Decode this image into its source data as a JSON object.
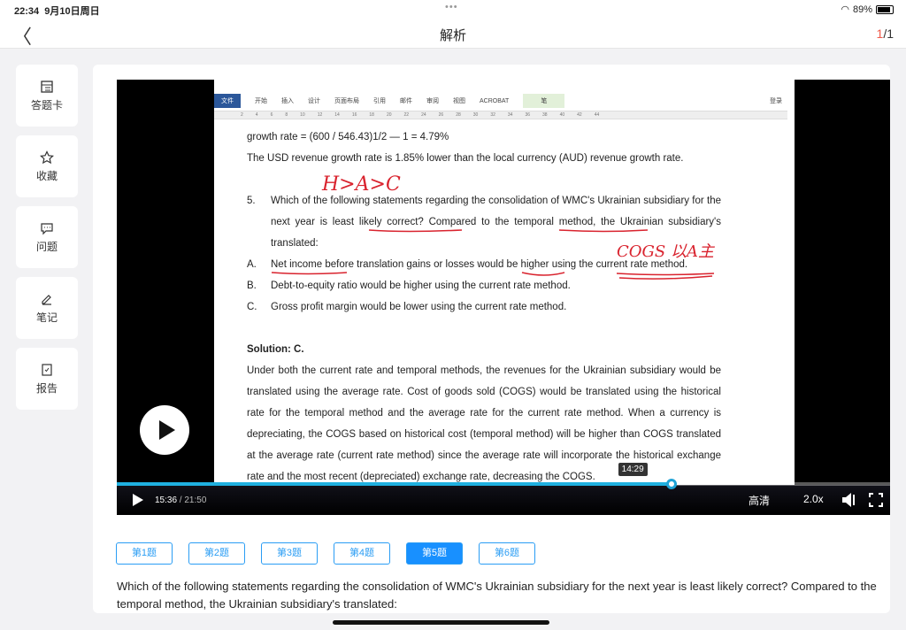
{
  "status": {
    "time": "22:34",
    "date": "9月10日周日",
    "battery": "89%"
  },
  "nav": {
    "title": "解析",
    "page_current": "1",
    "page_total": "/1"
  },
  "sidebar": [
    {
      "label": "答题卡"
    },
    {
      "label": "收藏"
    },
    {
      "label": "问题"
    },
    {
      "label": "笔记"
    },
    {
      "label": "报告"
    }
  ],
  "doc": {
    "ribbon": [
      "文件",
      "开始",
      "插入",
      "设计",
      "页面布局",
      "引用",
      "邮件",
      "审阅",
      "视图",
      "ACROBAT",
      "笔"
    ],
    "login": "登录",
    "ruler": [
      "2",
      "4",
      "6",
      "8",
      "10",
      "12",
      "14",
      "16",
      "18",
      "20",
      "22",
      "24",
      "26",
      "28",
      "30",
      "32",
      "34",
      "36",
      "38",
      "40",
      "42",
      "44"
    ],
    "line1": "growth rate = (600 / 546.43)1/2 — 1 = 4.79%",
    "line2": "The USD revenue growth rate is 1.85% lower than the local currency (AUD) revenue growth rate.",
    "q_num": "5.",
    "q_text": "Which of the following statements regarding the consolidation of WMC's Ukrainian subsidiary for the next year is least likely correct? Compared to the temporal method, the Ukrainian subsidiary's translated:",
    "options": [
      {
        "key": "A.",
        "text": "Net income before translation gains or losses would be higher using the current rate method."
      },
      {
        "key": "B.",
        "text": "Debt-to-equity ratio would be higher using the current rate method."
      },
      {
        "key": "C.",
        "text": "Gross profit margin would be lower using the current rate method."
      }
    ],
    "solution_title": "Solution: C.",
    "solution_text": "Under both the current rate and temporal methods, the revenues for the Ukrainian subsidiary would be translated using the average rate. Cost of goods sold (COGS) would be translated using the historical rate for the temporal method and the average rate for the current rate method. When a currency is depreciating, the COGS based on historical cost (temporal method) will be higher than COGS translated at the average rate (current rate method) since the average rate will incorporate the historical exchange rate and the most recent (depreciated) exchange rate, decreasing the COGS.",
    "handwriting": [
      "H>A>C",
      "COGS 以A主"
    ]
  },
  "player": {
    "current": "15:36",
    "total": " / 21:50",
    "tooltip": "14:29",
    "progress": 0.717,
    "quality": "高清",
    "speed": "2.0x",
    "accent": "#1fb0e0"
  },
  "tabs": [
    {
      "label": "第1题"
    },
    {
      "label": "第2题"
    },
    {
      "label": "第3题"
    },
    {
      "label": "第4题"
    },
    {
      "label": "第5题",
      "active": true
    },
    {
      "label": "第6题"
    }
  ],
  "question": "Which of the following statements regarding the consolidation of WMC's Ukrainian subsidiary for the next year is least likely correct? Compared to the temporal method, the Ukrainian subsidiary's translated:"
}
